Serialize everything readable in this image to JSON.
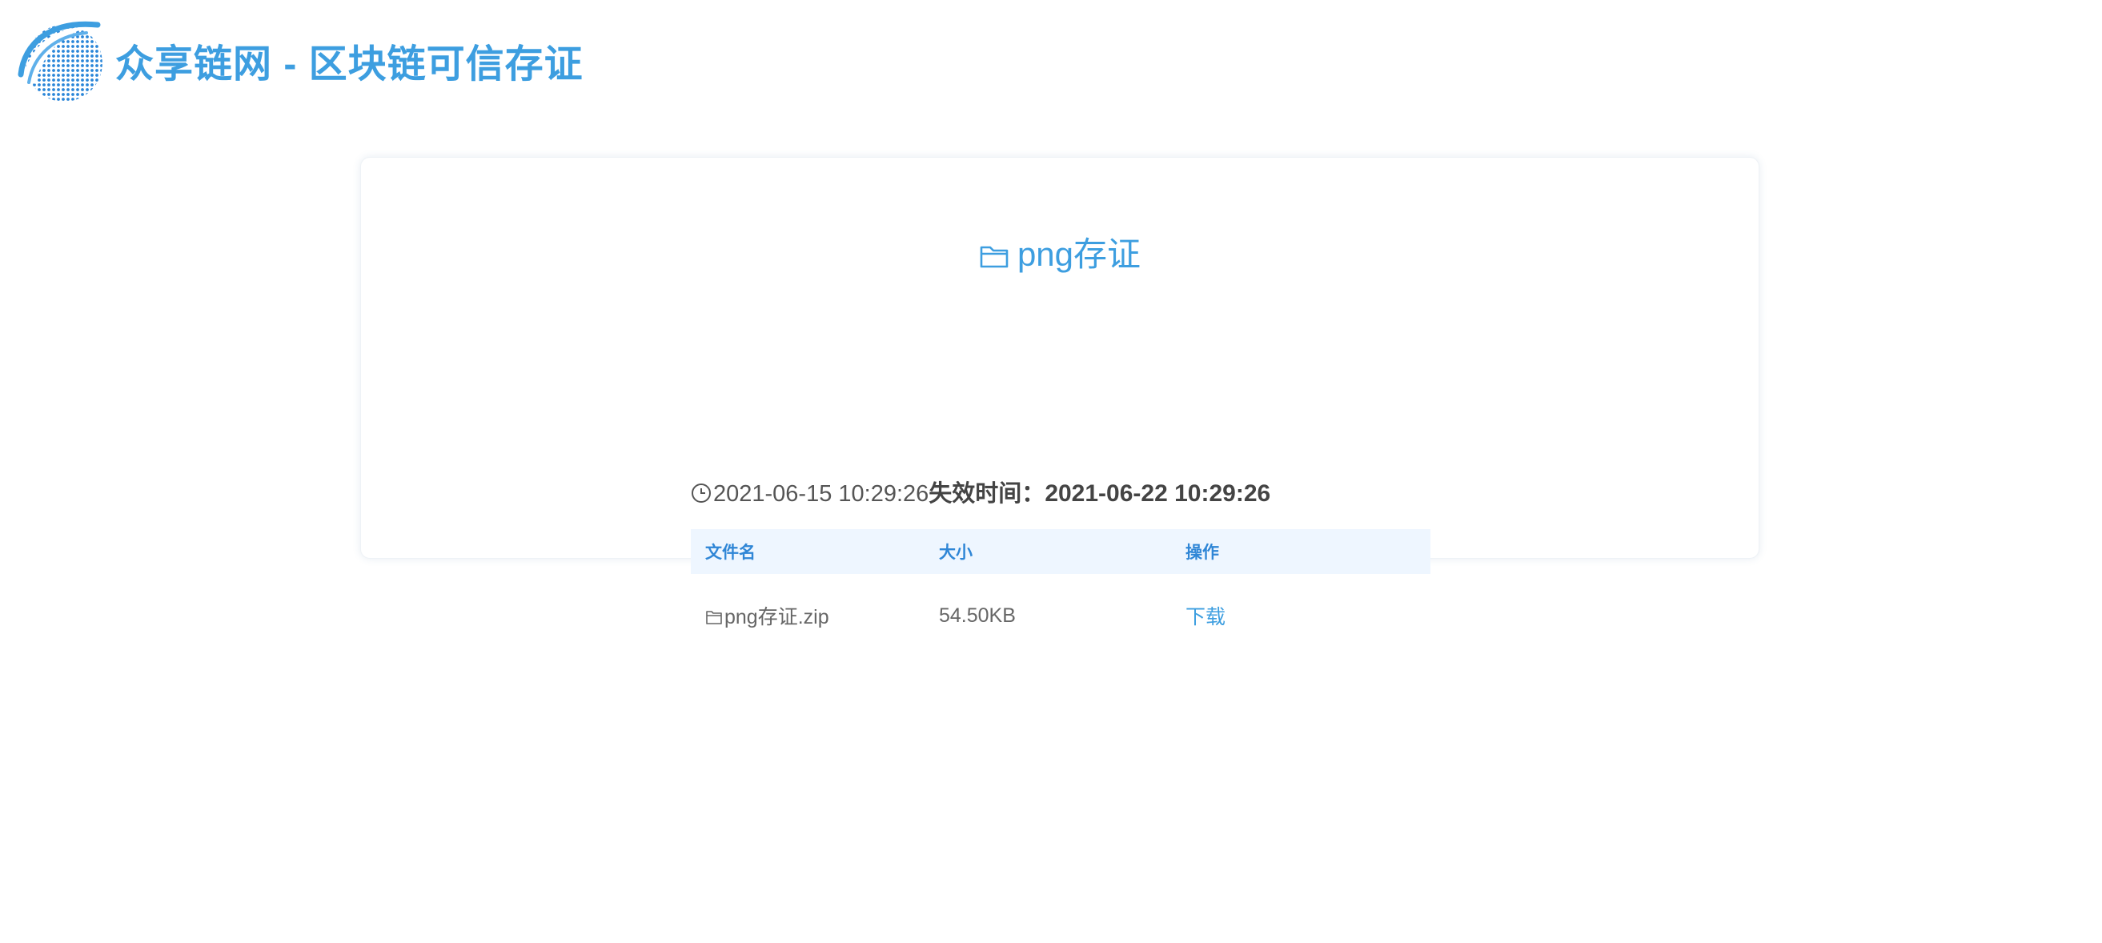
{
  "header": {
    "site_title": "众享链网 - 区块链可信存证",
    "logo_icon": "globe-arc-logo"
  },
  "card": {
    "title": "png存证",
    "title_icon": "folder-icon",
    "created_time": "2021-06-15 10:29:26",
    "expire_label": "失效时间：",
    "expire_value": "2021-06-22 10:29:26",
    "clock_icon": "clock-icon"
  },
  "table": {
    "headers": [
      "文件名",
      "大小",
      "操作"
    ],
    "rows": [
      {
        "filename": "png存证.zip",
        "size": "54.50KB",
        "action": "下载"
      }
    ]
  },
  "colors": {
    "accent": "#3d9ee0",
    "header_bg": "#eef6ff",
    "text": "#555555"
  }
}
